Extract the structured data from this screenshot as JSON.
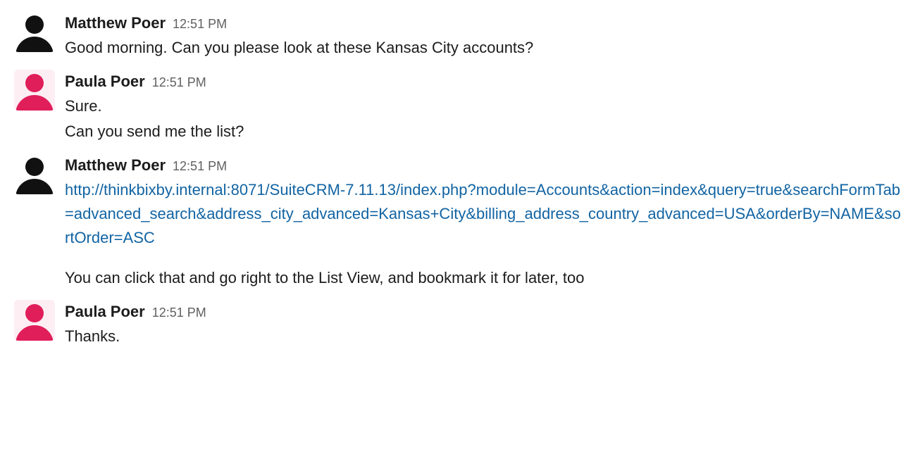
{
  "messages": [
    {
      "author": "Matthew Poer",
      "timestamp": "12:51 PM",
      "avatar": "dark",
      "lines": [
        {
          "text": "Good morning. Can you please look at these Kansas City accounts?",
          "type": "text"
        }
      ]
    },
    {
      "author": "Paula Poer",
      "timestamp": "12:51 PM",
      "avatar": "pink",
      "lines": [
        {
          "text": "Sure.",
          "type": "text"
        },
        {
          "text": "Can you send me the list?",
          "type": "text"
        }
      ]
    },
    {
      "author": "Matthew Poer",
      "timestamp": "12:51 PM",
      "avatar": "dark",
      "lines": [
        {
          "text": "http://thinkbixby.internal:8071/SuiteCRM-7.11.13/index.php?module=Accounts&action=index&query=true&searchFormTab=advanced_search&address_city_advanced=Kansas+City&billing_address_country_advanced=USA&orderBy=NAME&sortOrder=ASC",
          "type": "link"
        },
        {
          "text": "",
          "type": "spacer"
        },
        {
          "text": "You can click that and go right to the List View, and bookmark it for later, too",
          "type": "text"
        }
      ]
    },
    {
      "author": "Paula Poer",
      "timestamp": "12:51 PM",
      "avatar": "pink",
      "lines": [
        {
          "text": "Thanks.",
          "type": "text"
        }
      ]
    }
  ]
}
